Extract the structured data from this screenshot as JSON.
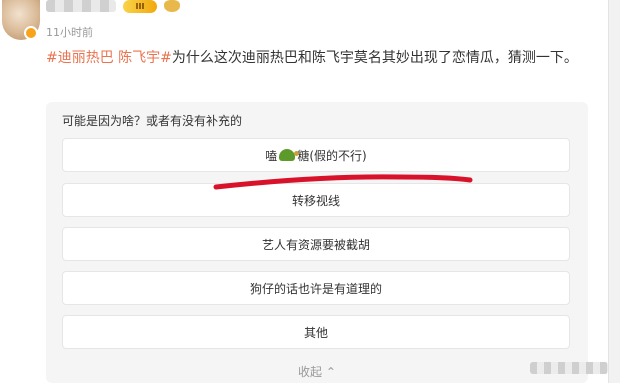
{
  "post": {
    "time": "11小时前",
    "level": "III",
    "hashtags": "#迪丽热巴 陈飞宇#",
    "text": "为什么这次迪丽热巴和陈飞宇莫名其妙出现了恋情瓜，猜测一下。"
  },
  "poll": {
    "question": "可能是因为啥？或者有没有补充的",
    "options": [
      {
        "before": "嗑",
        "emoji": "turtle-emoji",
        "after": "糖(假的不行)"
      },
      {
        "label": "转移视线"
      },
      {
        "label": "艺人有资源要被截胡"
      },
      {
        "label": "狗仔的话也许是有道理的"
      },
      {
        "label": "其他"
      }
    ],
    "collapse_label": "收起"
  },
  "colors": {
    "hashtag": "#eb7350",
    "scribble": "#d8122a",
    "poll_bg": "#f5f5f5"
  }
}
